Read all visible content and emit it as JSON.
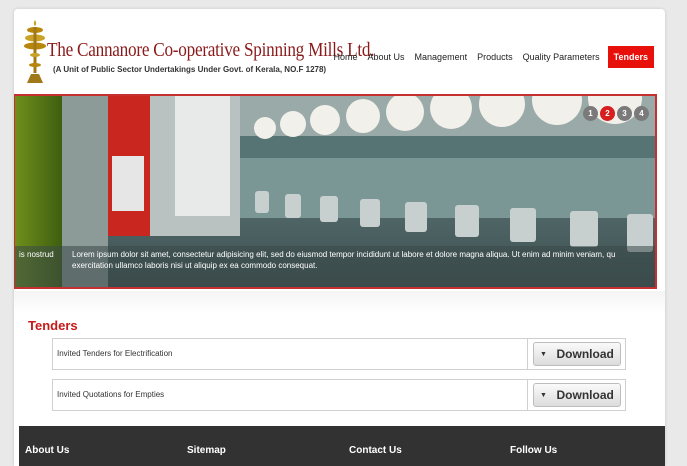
{
  "header": {
    "title": "The Cannanore Co-operative Spinning Mills Ltd.",
    "subtitle": "(A Unit of Public Sector Undertakings Under Govt. of Kerala, NO.F 1278)"
  },
  "nav": {
    "items": [
      {
        "label": "Home"
      },
      {
        "label": "About Us"
      },
      {
        "label": "Management"
      },
      {
        "label": "Products"
      },
      {
        "label": "Quality Parameters"
      },
      {
        "label": "Tenders"
      }
    ],
    "active": "Tenders"
  },
  "slider": {
    "pages": [
      "1",
      "2",
      "3",
      "4"
    ],
    "active_page": "2",
    "caption_left": "is nostrud",
    "caption_line1": "Lorem ipsum dolor sit amet, consectetur adipisicing elit, sed do eiusmod tempor incididunt ut labore et dolore magna aliqua. Ut enim ad minim veniam, qu",
    "caption_line2": "exercitation ullamco laboris nisi ut aliquip ex ea commodo consequat."
  },
  "tenders": {
    "title": "Tenders",
    "rows": [
      {
        "label": "Invited Tenders for Electrification",
        "button": "Download"
      },
      {
        "label": "Invited Quotations for Empties",
        "button": "Download"
      }
    ]
  },
  "footer": {
    "headings": [
      "About Us",
      "Sitemap",
      "Contact Us",
      "Follow Us"
    ]
  },
  "colors": {
    "accent": "#e8100a",
    "title": "#8b1a1a",
    "footer_bg": "#323232"
  }
}
